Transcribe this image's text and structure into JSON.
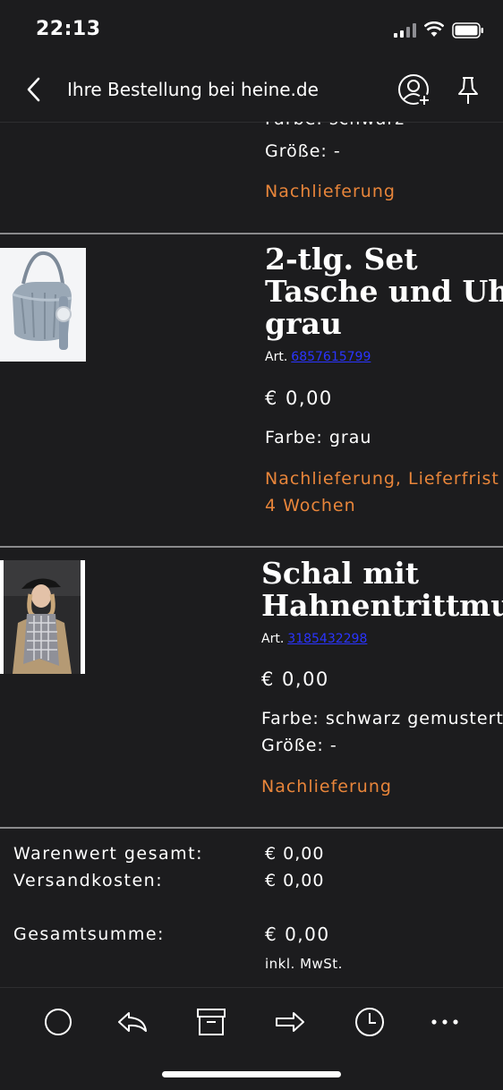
{
  "status_bar": {
    "time": "22:13"
  },
  "nav": {
    "title": "Ihre Bestellung bei heine.de"
  },
  "items": [
    {
      "color_label": "Farbe:",
      "color_value": "schwarz",
      "size_label": "Größe:",
      "size_value": "-",
      "delivery": "Nachlieferung"
    },
    {
      "name_lines": [
        "2-tlg. Set",
        "Tasche und Uhr",
        "grau"
      ],
      "art_label": "Art.",
      "art_number": "6857615799",
      "price": "€ 0,00",
      "color_label": "Farbe:",
      "color_value": "grau",
      "delivery_lines": [
        "Nachlieferung, Lieferfrist",
        "4 Wochen"
      ]
    },
    {
      "name_lines": [
        "Schal mit",
        "Hahnentrittmus"
      ],
      "art_label": "Art.",
      "art_number": "3185432298",
      "price": "€ 0,00",
      "color_label": "Farbe:",
      "color_value": "schwarz gemustert",
      "size_label": "Größe:",
      "size_value": "-",
      "delivery": "Nachlieferung"
    }
  ],
  "totals": {
    "goods_label": "Warenwert gesamt:",
    "goods_value": "€ 0,00",
    "shipping_label": "Versandkosten:",
    "shipping_value": "€ 0,00",
    "total_label": "Gesamtsumme:",
    "total_value": "€ 0,00",
    "tax_note": "inkl. MwSt."
  },
  "toolbar": {
    "icons": [
      "circle-icon",
      "reply-icon",
      "archive-icon",
      "forward-icon",
      "clock-icon",
      "more-icon"
    ]
  },
  "colors": {
    "accent_orange": "#e8853a",
    "link_blue": "#2a34ff",
    "background": "#1c1c1e"
  }
}
